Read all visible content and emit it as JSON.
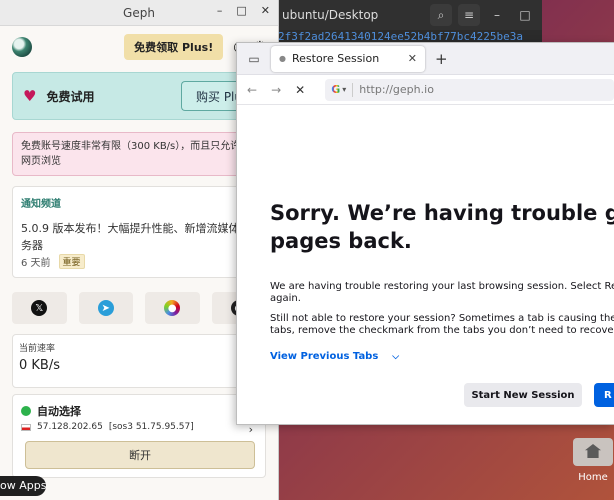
{
  "terminal": {
    "title": "ubuntu/Desktop",
    "line": "2f3f2ad2641340124ee52b4bf77bc4225be3a"
  },
  "geph": {
    "window_title": "Geph",
    "plus_button": "免费领取 Plus!",
    "trial": {
      "title": "免费试用",
      "buy": "购买 Plu"
    },
    "warning": {
      "line1": "免费账号速度非常有限（300 KB/s），而且只允许",
      "line2": "网页浏览"
    },
    "notice": {
      "heading": "通知频道",
      "line1": "5.0.9 版本发布！大幅提升性能、新增流媒体",
      "line2": "务器",
      "time": "6 天前",
      "badge": "重要"
    },
    "speed": {
      "label": "当前速率",
      "value": "0 KB/s"
    },
    "connection": {
      "mode": "自动选择",
      "ip": "57.128.202.65",
      "server": "[sos3 51.75.95.57]",
      "disconnect": "断开"
    }
  },
  "firefox": {
    "tab_title": "Restore Session",
    "url": "http://geph.io",
    "heading_line1": "Sorry. We’re having trouble getti",
    "heading_line2": "pages back.",
    "para1_line1": "We are having trouble restoring your last browsing session. Select Restore",
    "para1_line2": "again.",
    "para2_line1": "Still not able to restore your session? Sometimes a tab is causing the issue.",
    "para2_line2": "tabs, remove the checkmark from the tabs you don’t need to recover, and t",
    "view_tabs": "View Previous Tabs",
    "start_new": "Start New Session",
    "restore_fragment": "R"
  },
  "desktop": {
    "home_label": "Home",
    "show_apps": "ow Apps"
  },
  "colors": {
    "trial_bg": "#c6e9e5",
    "warning_bg": "#fbe4ec",
    "accent_green": "#2d7d70",
    "firefox_blue": "#0061e0"
  }
}
